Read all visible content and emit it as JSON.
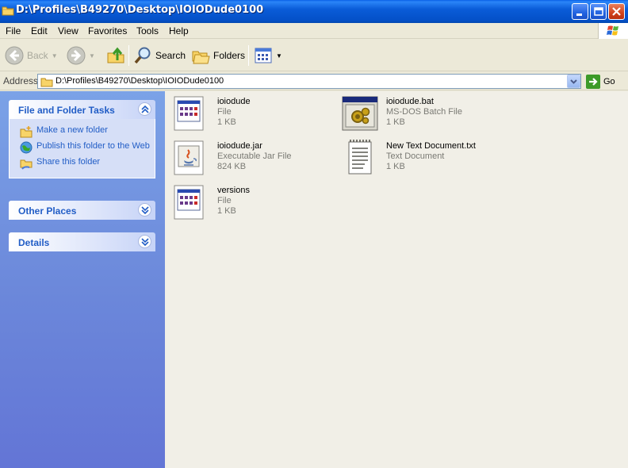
{
  "window": {
    "title": "D:\\Profiles\\B49270\\Desktop\\IOIODude0100"
  },
  "menu": [
    "File",
    "Edit",
    "View",
    "Favorites",
    "Tools",
    "Help"
  ],
  "toolbar": {
    "back_label": "Back",
    "search_label": "Search",
    "folders_label": "Folders"
  },
  "address": {
    "label": "Address",
    "value": "D:\\Profiles\\B49270\\Desktop\\IOIODude0100",
    "go_label": "Go"
  },
  "left_pane": {
    "file_tasks": {
      "title": "File and Folder Tasks",
      "tasks": [
        {
          "label": "Make a new folder",
          "icon": "new-folder-icon"
        },
        {
          "label": "Publish this folder to the Web",
          "icon": "publish-web-icon"
        },
        {
          "label": "Share this folder",
          "icon": "share-folder-icon"
        }
      ]
    },
    "other_places": {
      "title": "Other Places"
    },
    "details": {
      "title": "Details"
    }
  },
  "files": [
    {
      "name": "ioiodude",
      "type": "File",
      "size": "1 KB",
      "icon": "generic-file-icon"
    },
    {
      "name": "ioiodude.bat",
      "type": "MS-DOS Batch File",
      "size": "1 KB",
      "icon": "batch-file-icon"
    },
    {
      "name": "ioiodude.jar",
      "type": "Executable Jar File",
      "size": "824 KB",
      "icon": "jar-file-icon"
    },
    {
      "name": "New Text Document.txt",
      "type": "Text Document",
      "size": "1 KB",
      "icon": "text-document-icon"
    },
    {
      "name": "versions",
      "type": "File",
      "size": "1 KB",
      "icon": "generic-file-icon"
    }
  ],
  "colors": {
    "titlebar": "#0a5cd8",
    "taskpane_link": "#215dc6",
    "left_pane_bg": "#6b87da"
  }
}
